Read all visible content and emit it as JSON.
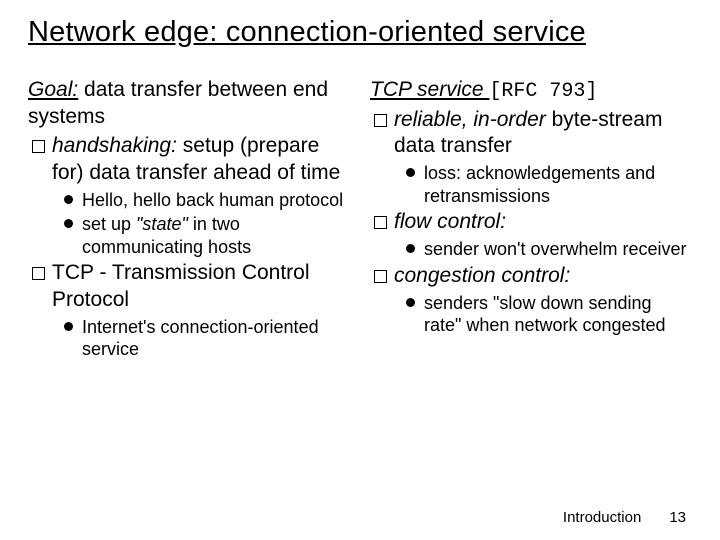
{
  "title": "Network edge: connection-oriented service",
  "left": {
    "goal_label": "Goal:",
    "goal_text": " data transfer between end systems",
    "b1_ital": "handshaking:",
    "b1_rest": " setup (prepare for) data transfer ahead of time",
    "b1s1": "Hello, hello back human protocol",
    "b1s2_pre": "set up ",
    "b1s2_ital": "\"state\"",
    "b1s2_post": " in two communicating hosts",
    "b2": "TCP - Transmission Control Protocol",
    "b2s1": "Internet's connection-oriented service"
  },
  "right": {
    "head": "TCP service ",
    "ref": "[RFC 793]",
    "r1_ital": "reliable, in-order",
    "r1_rest": " byte-stream data transfer",
    "r1s1": "loss: acknowledgements and retransmissions",
    "r2": "flow control:",
    "r2s1": "sender won't overwhelm receiver",
    "r3": "congestion control:",
    "r3s1": "senders \"slow down sending rate\" when network congested"
  },
  "footer": {
    "section": "Introduction",
    "page": "13"
  }
}
